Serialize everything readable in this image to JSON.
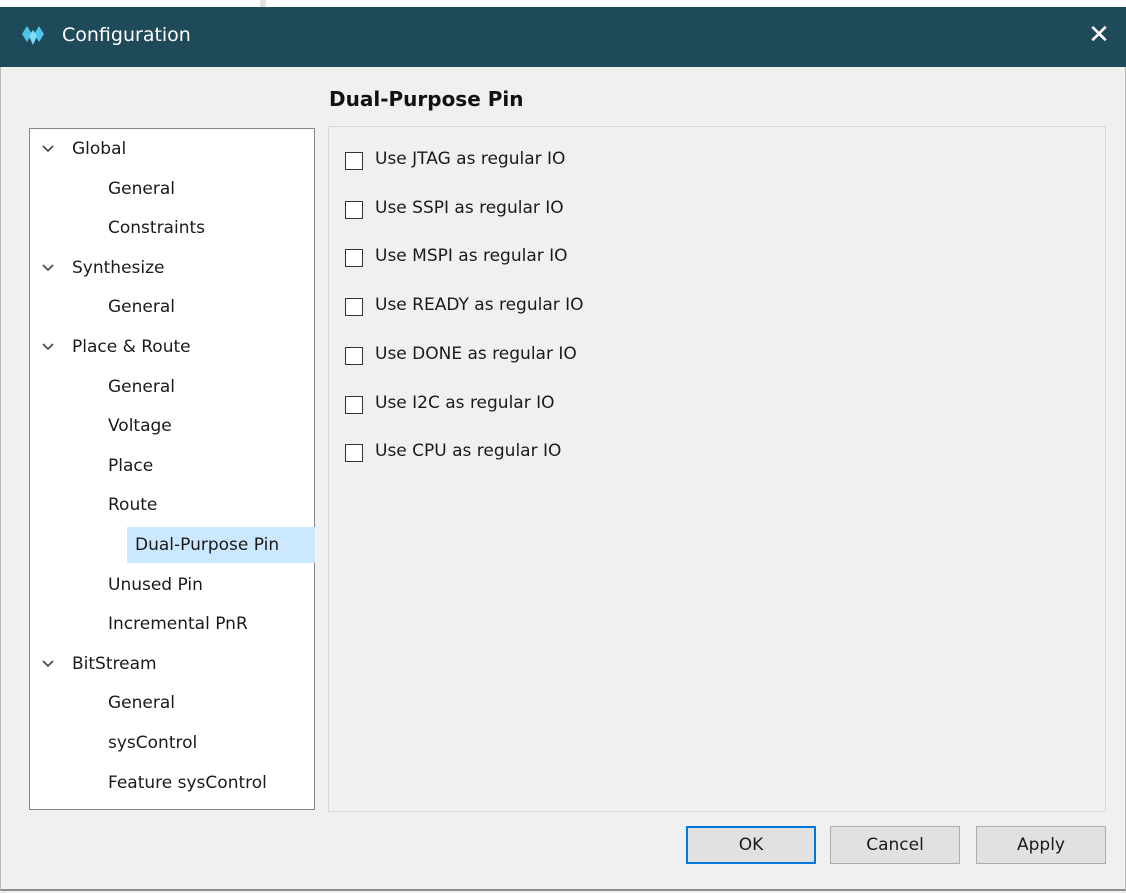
{
  "window": {
    "title": "Configuration",
    "close_glyph": "✕",
    "icon": "gowin-logo-icon",
    "titlebar_color": "#1f4a5a"
  },
  "page_title": "Dual-Purpose Pin",
  "tree": {
    "chevron_icon": "chevron-down-icon",
    "items": [
      {
        "label": "Global",
        "level": 0,
        "expanded": true
      },
      {
        "label": "General",
        "level": 1
      },
      {
        "label": "Constraints",
        "level": 1
      },
      {
        "label": "Synthesize",
        "level": 0,
        "expanded": true
      },
      {
        "label": "General",
        "level": 1
      },
      {
        "label": "Place & Route",
        "level": 0,
        "expanded": true
      },
      {
        "label": "General",
        "level": 1
      },
      {
        "label": "Voltage",
        "level": 1
      },
      {
        "label": "Place",
        "level": 1
      },
      {
        "label": "Route",
        "level": 1
      },
      {
        "label": "Dual-Purpose Pin",
        "level": 1,
        "selected": true
      },
      {
        "label": "Unused Pin",
        "level": 1
      },
      {
        "label": "Incremental PnR",
        "level": 1
      },
      {
        "label": "BitStream",
        "level": 0,
        "expanded": true
      },
      {
        "label": "General",
        "level": 1
      },
      {
        "label": "sysControl",
        "level": 1
      },
      {
        "label": "Feature sysControl",
        "level": 1
      }
    ],
    "selection_color": "#cce8ff"
  },
  "options": [
    {
      "label": "Use JTAG as regular IO",
      "checked": false
    },
    {
      "label": "Use SSPI as regular IO",
      "checked": false
    },
    {
      "label": "Use MSPI as regular IO",
      "checked": false
    },
    {
      "label": "Use READY as regular IO",
      "checked": false
    },
    {
      "label": "Use DONE as regular IO",
      "checked": false
    },
    {
      "label": "Use I2C as regular IO",
      "checked": false
    },
    {
      "label": "Use CPU  as regular IO",
      "checked": false
    }
  ],
  "buttons": {
    "ok": "OK",
    "cancel": "Cancel",
    "apply": "Apply",
    "default_border_color": "#0078d7"
  }
}
